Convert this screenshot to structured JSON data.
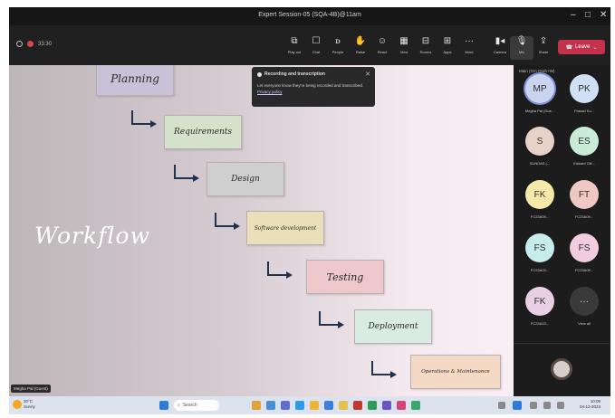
{
  "window": {
    "title": "Expert Session-05 (SQA-4B)@11am"
  },
  "meeting": {
    "timer": "33:30",
    "toolbar": [
      {
        "label": "Play out",
        "icon": "pop-out-icon"
      },
      {
        "label": "Chat",
        "icon": "chat-icon"
      },
      {
        "label": "People",
        "icon": "people-icon"
      },
      {
        "label": "Raise",
        "icon": "raise-hand-icon"
      },
      {
        "label": "React",
        "icon": "react-icon"
      },
      {
        "label": "View",
        "icon": "view-icon"
      },
      {
        "label": "Rooms",
        "icon": "rooms-icon"
      },
      {
        "label": "Apps",
        "icon": "apps-icon"
      },
      {
        "label": "More",
        "icon": "more-icon"
      },
      {
        "label": "Camera",
        "icon": "camera-icon"
      },
      {
        "label": "Mic",
        "icon": "mic-icon"
      },
      {
        "label": "Share",
        "icon": "share-icon"
      }
    ],
    "leave_label": "Leave"
  },
  "notification": {
    "title": "Recording and transcription",
    "body": "Let everyone know they're being recorded and transcribed.",
    "link": "Privacy policy"
  },
  "slide": {
    "heading": "Workflow",
    "steps": [
      "Planning",
      "Requirements",
      "Design",
      "Software development",
      "Testing",
      "Deployment",
      "Operations & Maintenance"
    ],
    "colors": [
      "#c8c1d8",
      "#d5e2cb",
      "#cfcfcf",
      "#eadfb8",
      "#efc8cb",
      "#d9ece2",
      "#f4d9c4"
    ]
  },
  "presenter_label": "Megha Pal (Guest)",
  "panel": {
    "header": "Main (Gm Orah+W)",
    "participants": [
      {
        "initials": "MP",
        "name": "Megha Pal (Gue...",
        "color": "#c9d4ef"
      },
      {
        "initials": "PK",
        "name": "Prasad Ku...",
        "color": "#cfe0f5"
      },
      {
        "initials": "S",
        "name": "SUNDAS (...",
        "color": "#e7d2c8"
      },
      {
        "initials": "ES",
        "name": "Edward Clif...",
        "color": "#c8ecd6"
      },
      {
        "initials": "FK",
        "name": "FC23A09...",
        "color": "#f6e8a8"
      },
      {
        "initials": "FT",
        "name": "FC23A09...",
        "color": "#efc8c4"
      },
      {
        "initials": "FS",
        "name": "FC23A03...",
        "color": "#c6ecec"
      },
      {
        "initials": "FS",
        "name": "FC23A09...",
        "color": "#f2cde0"
      },
      {
        "initials": "FK",
        "name": "FC23A13...",
        "color": "#e9cfe3"
      },
      {
        "initials": "···",
        "name": "View all",
        "color": "#3a3a3a"
      }
    ]
  },
  "taskbar": {
    "weather_temp": "30°C",
    "weather_desc": "Sunny",
    "search_label": "Search",
    "time": "10:09",
    "date": "04-12-2023"
  }
}
